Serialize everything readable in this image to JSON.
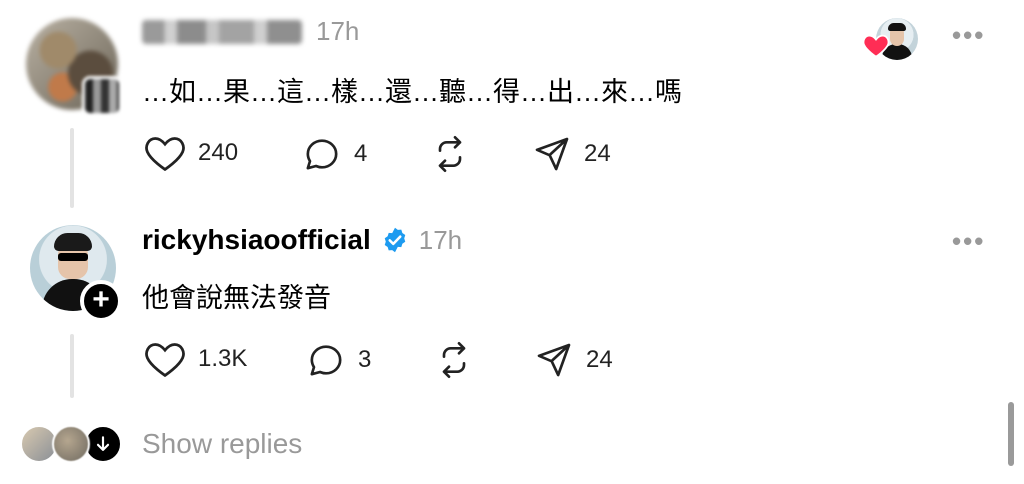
{
  "thread": [
    {
      "username": "",
      "time": "17h",
      "comment": "…如…果…這…樣…還…聽…得…出…來…嗎",
      "likes": "240",
      "replies": "4",
      "shares": "24",
      "liked_by_author": true
    },
    {
      "username": "rickyhsiaoofficial",
      "verified": true,
      "time": "17h",
      "comment": "他會說無法發音",
      "likes": "1.3K",
      "replies": "3",
      "shares": "24"
    }
  ],
  "footer": {
    "show_replies_label": "Show replies"
  },
  "colors": {
    "verified": "#1d9bf0",
    "heart": "#ff2d55",
    "muted": "#999999",
    "thread_line": "#e3e3e3"
  },
  "icons": [
    "heart-icon",
    "comment-icon",
    "repost-icon",
    "send-icon",
    "more-icon",
    "verified-badge-icon",
    "plus-icon",
    "arrow-down-icon"
  ]
}
